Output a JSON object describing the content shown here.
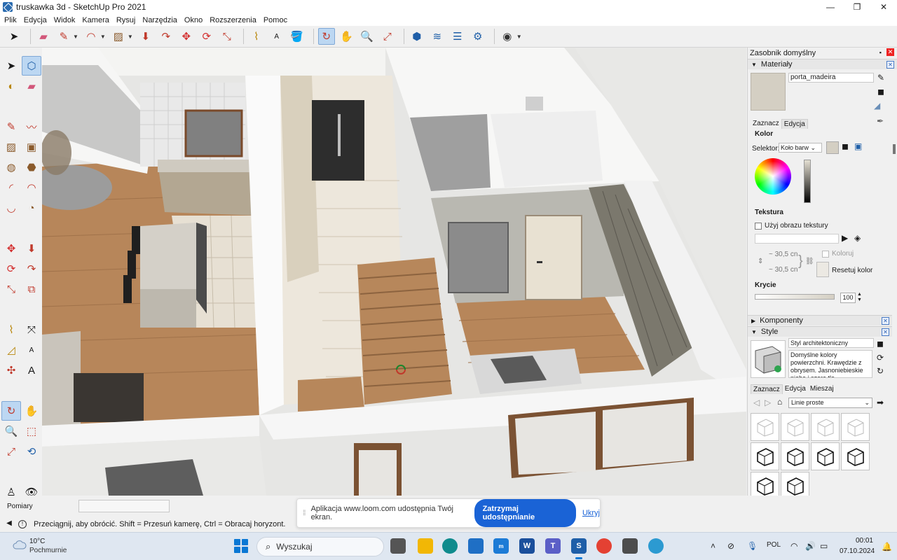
{
  "window": {
    "title": "truskawka 3d - SketchUp Pro 2021",
    "controls": {
      "minimize": "—",
      "maximize": "❐",
      "close": "✕"
    }
  },
  "menu": [
    "Plik",
    "Edycja",
    "Widok",
    "Kamera",
    "Rysuj",
    "Narzędzia",
    "Okno",
    "Rozszerzenia",
    "Pomoc"
  ],
  "toolbar_icons": [
    "select-icon",
    "eraser-icon",
    "pencil-icon",
    "arc-icon",
    "rectangle-icon",
    "push-pull-icon",
    "follow-me-icon",
    "move-icon",
    "rotate-icon",
    "scale-icon",
    "tape-measure-icon",
    "text-icon",
    "paint-bucket-icon",
    "orbit-icon",
    "pan-icon",
    "zoom-icon",
    "zoom-extents-icon",
    "warehouse-icon",
    "extension-warehouse-icon",
    "layout-icon",
    "extension-manager-icon",
    "profile-icon"
  ],
  "left_tools": [
    "select-icon",
    "component-icon",
    "paint-bucket-icon",
    "eraser-icon",
    "line-icon",
    "freehand-icon",
    "rectangle-icon",
    "rotated-rectangle-icon",
    "circle-icon",
    "polygon-icon",
    "arc-icon",
    "two-point-arc-icon",
    "three-point-arc-icon",
    "pie-icon",
    "move-icon",
    "push-pull-icon",
    "rotate-icon",
    "follow-me-icon",
    "scale-icon",
    "offset-icon",
    "tape-measure-icon",
    "dimension-icon",
    "protractor-icon",
    "text-icon",
    "axes-icon",
    "3d-text-icon",
    "orbit-icon",
    "pan-icon",
    "zoom-icon",
    "zoom-window-icon",
    "zoom-extents-icon",
    "previous-view-icon",
    "position-camera-icon",
    "look-around-icon",
    "walk-icon",
    "section-plane-icon",
    "warehouse-icon",
    "extension-warehouse-icon",
    "layout-icon",
    "extension-manager-icon"
  ],
  "tray": {
    "title": "Zasobnik domyślny",
    "materials": {
      "header": "Materiały",
      "name": "porta_madeira",
      "tabs": [
        "Zaznacz",
        "Edycja"
      ],
      "color_label": "Kolor",
      "selector_label": "Selektor:",
      "selector_value": "Koło barw",
      "texture_label": "Tekstura",
      "use_texture": "Użyj obrazu tekstury",
      "width": "~ 30,5 cn",
      "height": "~ 30,5 cn",
      "colorize": "Koloruj",
      "reset_color": "Resetuj kolor",
      "opacity_label": "Krycie",
      "opacity_value": "100",
      "swatch_color": "#d4cfc3"
    },
    "components_header": "Komponenty",
    "styles": {
      "header": "Style",
      "name": "Styl architektoniczny",
      "description": "Domyślne kolory powierzchni. Krawędzie z obrysem. Jasnoniebieskie niebo i szare tło.",
      "tabs": [
        "Zaznacz",
        "Edycja",
        "Mieszaj"
      ],
      "collection": "Linie proste",
      "thumb_count": 10
    }
  },
  "measurements": {
    "label": "Pomiary",
    "value": ""
  },
  "status": {
    "hint": "Przeciągnij, aby obrócić. Shift = Przesuń kamerę, Ctrl = Obracaj horyzont."
  },
  "loom": {
    "message": "Aplikacja www.loom.com udostępnia Twój ekran.",
    "stop_button": "Zatrzymaj udostępnianie",
    "hide_link": "Ukryj"
  },
  "taskbar": {
    "weather_temp": "10°C",
    "weather_desc": "Pochmurnie",
    "search_placeholder": "Wyszukaj",
    "language": "POL",
    "time": "00:01",
    "date": "07.10.2024"
  }
}
